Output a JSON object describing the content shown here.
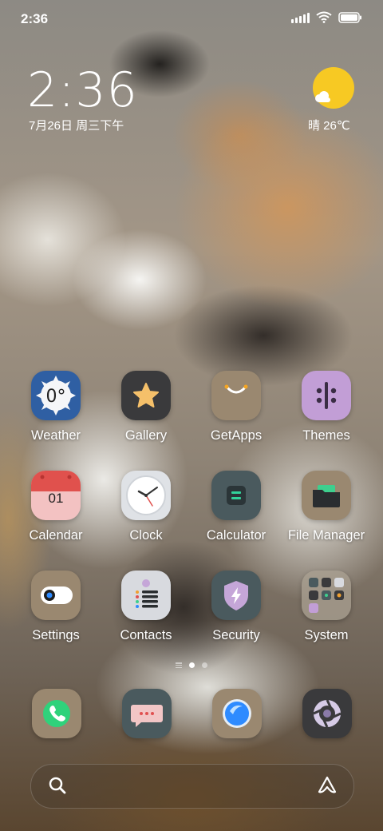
{
  "status_bar": {
    "time": "2:36",
    "icons": [
      "signal-icon",
      "wifi-icon",
      "battery-icon"
    ]
  },
  "clock_widget": {
    "time": "2:36",
    "date": "7月26日 周三下午"
  },
  "weather_widget": {
    "condition": "晴 26℃",
    "icon": "sunny-cloud-icon",
    "sun_color": "#f7c923"
  },
  "apps": [
    {
      "label": "Weather",
      "icon": "weather-icon",
      "icon_text": "0°"
    },
    {
      "label": "Gallery",
      "icon": "gallery-star-icon"
    },
    {
      "label": "GetApps",
      "icon": "getapps-bag-icon"
    },
    {
      "label": "Themes",
      "icon": "themes-icon"
    },
    {
      "label": "Calendar",
      "icon": "calendar-icon",
      "icon_text": "01"
    },
    {
      "label": "Clock",
      "icon": "clock-icon"
    },
    {
      "label": "Calculator",
      "icon": "calculator-icon"
    },
    {
      "label": "File Manager",
      "icon": "folder-icon"
    },
    {
      "label": "Settings",
      "icon": "toggle-settings-icon"
    },
    {
      "label": "Contacts",
      "icon": "contacts-icon"
    },
    {
      "label": "Security",
      "icon": "security-shield-icon"
    },
    {
      "label": "System",
      "icon": "system-folder-icon"
    }
  ],
  "page_indicator": {
    "pages": 2,
    "active": 1
  },
  "dock": [
    {
      "icon": "phone-icon"
    },
    {
      "icon": "messages-icon"
    },
    {
      "icon": "browser-icon"
    },
    {
      "icon": "camera-icon"
    }
  ],
  "bottom_bar": {
    "left_icon": "search-icon",
    "right_icon": "assistant-icon"
  }
}
